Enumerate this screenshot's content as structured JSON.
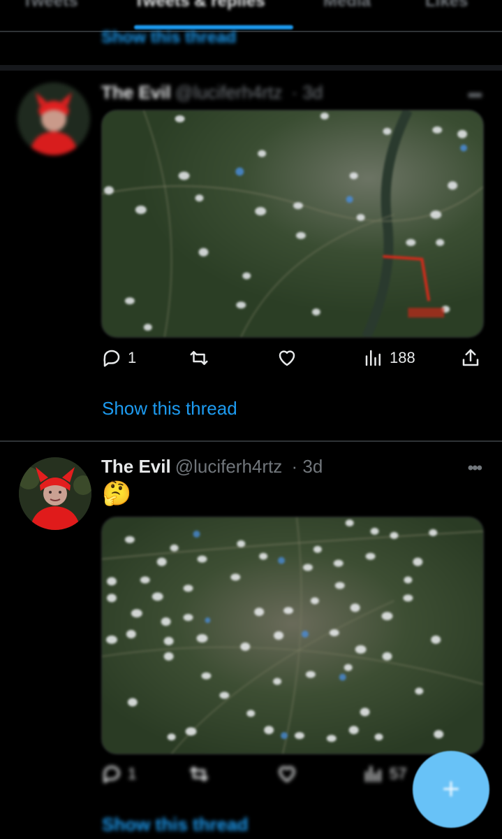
{
  "tabs": [
    {
      "label": "Tweets"
    },
    {
      "label": "Tweets & replies"
    },
    {
      "label": "Media"
    },
    {
      "label": "Likes"
    }
  ],
  "active_tab": "Tweets & replies",
  "previous_show_thread": "Show this thread",
  "colors": {
    "accent": "#1d9bf0",
    "background": "#000000",
    "secondary_text": "#71767b"
  },
  "tweets": [
    {
      "name": "The Evil",
      "handle": "@luciferh4rtz",
      "time": "· 3d",
      "more": "•••",
      "text": "",
      "media": "map-satellite-image",
      "replies": "1",
      "retweets": "",
      "likes": "",
      "views": "188",
      "show_thread": "Show this thread"
    },
    {
      "name": "The Evil",
      "handle": "@luciferh4rtz",
      "time": "· 3d",
      "more": "•••",
      "text": "🤔",
      "media": "map-satellite-image",
      "replies": "1",
      "retweets": "",
      "likes": "",
      "views": "57",
      "show_thread": "Show this thread"
    }
  ],
  "fab": {
    "icon": "plus-icon",
    "label": "+"
  }
}
